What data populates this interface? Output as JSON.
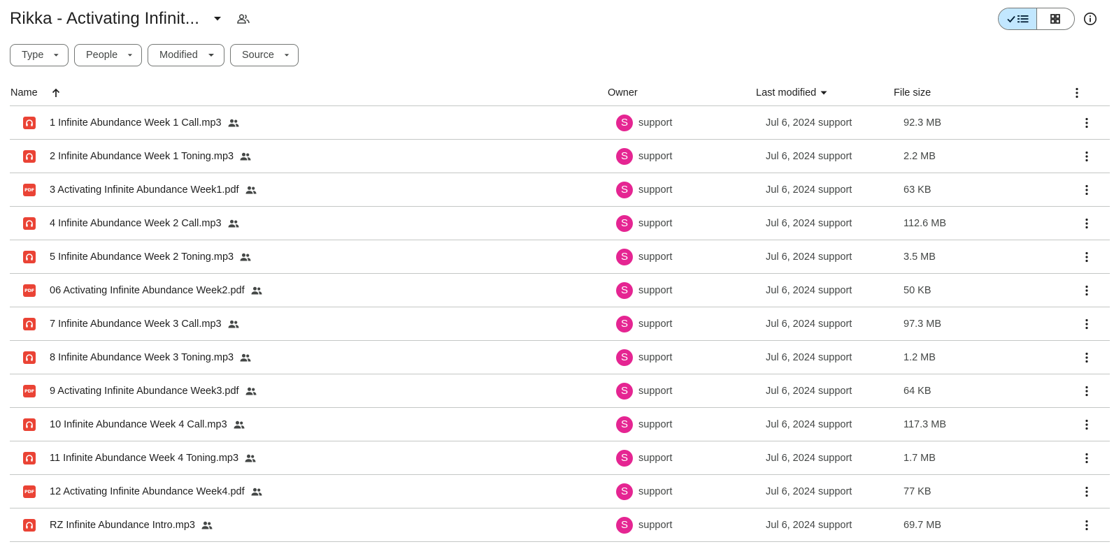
{
  "header": {
    "title": "Rikka - Activating Infinit...",
    "view_list_label": "list view",
    "view_grid_label": "grid view"
  },
  "filters": [
    {
      "label": "Type"
    },
    {
      "label": "People"
    },
    {
      "label": "Modified"
    },
    {
      "label": "Source"
    }
  ],
  "columns": {
    "name": "Name",
    "owner": "Owner",
    "last_modified": "Last modified",
    "file_size": "File size"
  },
  "colors": {
    "accent": "#c2e7ff",
    "avatar": "#e52592",
    "file_icon": "#ea4335"
  },
  "files": [
    {
      "name": "1 Infinite Abundance Week 1 Call.mp3",
      "type": "audio",
      "owner_initial": "S",
      "owner": "support",
      "modified": "Jul 6, 2024 support",
      "size": "92.3 MB"
    },
    {
      "name": "2 Infinite Abundance Week 1 Toning.mp3",
      "type": "audio",
      "owner_initial": "S",
      "owner": "support",
      "modified": "Jul 6, 2024 support",
      "size": "2.2 MB"
    },
    {
      "name": "3 Activating Infinite Abundance Week1.pdf",
      "type": "pdf",
      "owner_initial": "S",
      "owner": "support",
      "modified": "Jul 6, 2024 support",
      "size": "63 KB"
    },
    {
      "name": "4 Infinite Abundance Week 2 Call.mp3",
      "type": "audio",
      "owner_initial": "S",
      "owner": "support",
      "modified": "Jul 6, 2024 support",
      "size": "112.6 MB"
    },
    {
      "name": "5 Infinite Abundance Week 2 Toning.mp3",
      "type": "audio",
      "owner_initial": "S",
      "owner": "support",
      "modified": "Jul 6, 2024 support",
      "size": "3.5 MB"
    },
    {
      "name": "06 Activating Infinite Abundance Week2.pdf",
      "type": "pdf",
      "owner_initial": "S",
      "owner": "support",
      "modified": "Jul 6, 2024 support",
      "size": "50 KB"
    },
    {
      "name": "7 Infinite Abundance Week 3 Call.mp3",
      "type": "audio",
      "owner_initial": "S",
      "owner": "support",
      "modified": "Jul 6, 2024 support",
      "size": "97.3 MB"
    },
    {
      "name": "8 Infinite Abundance Week 3 Toning.mp3",
      "type": "audio",
      "owner_initial": "S",
      "owner": "support",
      "modified": "Jul 6, 2024 support",
      "size": "1.2 MB"
    },
    {
      "name": "9 Activating Infinite Abundance Week3.pdf",
      "type": "pdf",
      "owner_initial": "S",
      "owner": "support",
      "modified": "Jul 6, 2024 support",
      "size": "64 KB"
    },
    {
      "name": "10 Infinite Abundance Week 4 Call.mp3",
      "type": "audio",
      "owner_initial": "S",
      "owner": "support",
      "modified": "Jul 6, 2024 support",
      "size": "117.3 MB"
    },
    {
      "name": "11 Infinite Abundance Week 4 Toning.mp3",
      "type": "audio",
      "owner_initial": "S",
      "owner": "support",
      "modified": "Jul 6, 2024 support",
      "size": "1.7 MB"
    },
    {
      "name": "12 Activating Infinite Abundance Week4.pdf",
      "type": "pdf",
      "owner_initial": "S",
      "owner": "support",
      "modified": "Jul 6, 2024 support",
      "size": "77 KB"
    },
    {
      "name": "RZ Infinite Abundance Intro.mp3",
      "type": "audio",
      "owner_initial": "S",
      "owner": "support",
      "modified": "Jul 6, 2024 support",
      "size": "69.7 MB"
    }
  ]
}
